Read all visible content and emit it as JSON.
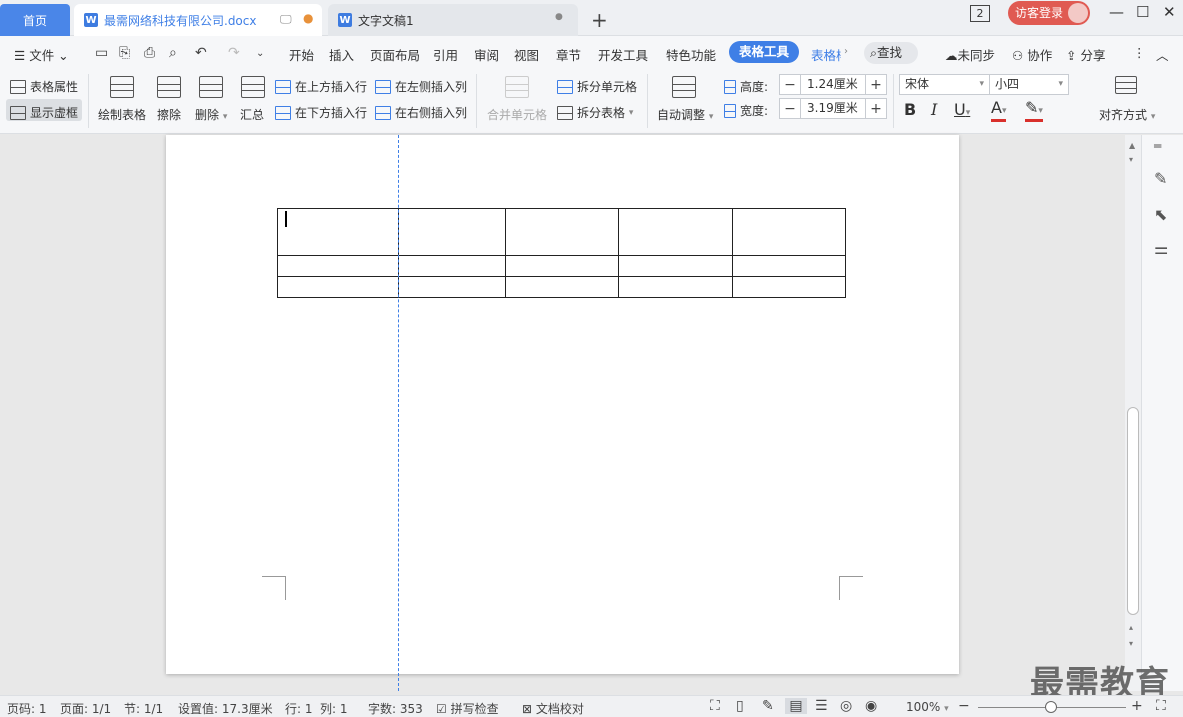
{
  "titlebar": {
    "home_tab": "首页",
    "doc_tab": "最需网络科技有限公司.docx",
    "doc2_tab": "文字文稿1",
    "doc_icon": "W",
    "badge": "2",
    "login": "访客登录"
  },
  "menubar": {
    "file": "文件",
    "items": [
      "开始",
      "插入",
      "页面布局",
      "引用",
      "审阅",
      "视图",
      "章节",
      "开发工具",
      "特色功能"
    ],
    "active": "表格工具",
    "next": "表格样",
    "search": "查找",
    "sync": "未同步",
    "collab": "协作",
    "share": "分享"
  },
  "ribbon": {
    "table_props": "表格属性",
    "show_grid": "显示虚框",
    "draw_table": "绘制表格",
    "erase": "擦除",
    "delete": "删除",
    "summary": "汇总",
    "insert_above": "在上方插入行",
    "insert_below": "在下方插入行",
    "insert_left": "在左侧插入列",
    "insert_right": "在右侧插入列",
    "merge_cells": "合并单元格",
    "split_cells": "拆分单元格",
    "split_table": "拆分表格",
    "auto_adjust": "自动调整",
    "height_label": "高度:",
    "height_value": "1.24厘米",
    "width_label": "宽度:",
    "width_value": "3.19厘米",
    "font": "宋体",
    "font_size": "小四",
    "align": "对齐方式"
  },
  "statusbar": {
    "page_num": "页码: 1",
    "pages": "页面: 1/1",
    "section": "节: 1/1",
    "setting": "设置值: 17.3厘米",
    "row": "行: 1",
    "col": "列: 1",
    "words": "字数: 353",
    "spell": "拼写检查",
    "proof": "文档校对",
    "zoom": "100%"
  },
  "watermark": "最需教育",
  "colors": {
    "accent": "#3f7fe6",
    "login": "#e05a52",
    "font_color_underline": "#d9302c"
  }
}
